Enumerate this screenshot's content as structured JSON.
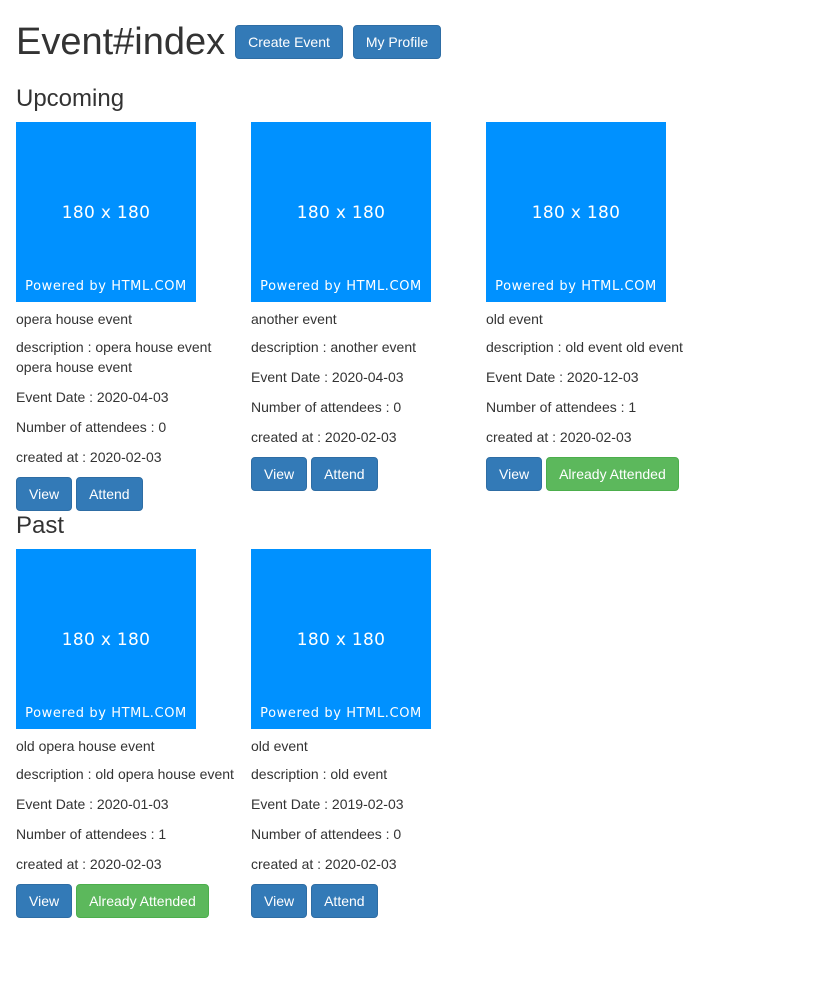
{
  "header": {
    "title": "Event#index",
    "create_event_label": "Create Event",
    "my_profile_label": "My Profile"
  },
  "upcoming": {
    "title": "Upcoming",
    "events": [
      {
        "image_size": "180 x 180",
        "image_caption": "Powered by HTML.COM",
        "name": "opera house event",
        "description": "description : opera house event opera house event",
        "event_date": "Event Date : 2020-04-03",
        "attendees": "Number of attendees : 0",
        "created_at": "created at : 2020-02-03",
        "view_label": "View",
        "attend_label": "Attend"
      },
      {
        "image_size": "180 x 180",
        "image_caption": "Powered by HTML.COM",
        "name": "another event",
        "description": "description : another event",
        "event_date": "Event Date : 2020-04-03",
        "attendees": "Number of attendees : 0",
        "created_at": "created at : 2020-02-03",
        "view_label": "View",
        "attend_label": "Attend"
      },
      {
        "image_size": "180 x 180",
        "image_caption": "Powered by HTML.COM",
        "name": "old event",
        "description": "description : old event old event",
        "event_date": "Event Date : 2020-12-03",
        "attendees": "Number of attendees : 1",
        "created_at": "created at : 2020-02-03",
        "view_label": "View",
        "attend_label": "Already Attended"
      }
    ]
  },
  "past": {
    "title": "Past",
    "events": [
      {
        "image_size": "180 x 180",
        "image_caption": "Powered by HTML.COM",
        "name": "old opera house event",
        "description": "description : old opera house event",
        "event_date": "Event Date : 2020-01-03",
        "attendees": "Number of attendees : 1",
        "created_at": "created at : 2020-02-03",
        "view_label": "View",
        "attend_label": "Already Attended"
      },
      {
        "image_size": "180 x 180",
        "image_caption": "Powered by HTML.COM",
        "name": "old event",
        "description": "description : old event",
        "event_date": "Event Date : 2019-02-03",
        "attendees": "Number of attendees : 0",
        "created_at": "created at : 2020-02-03",
        "view_label": "View",
        "attend_label": "Attend"
      }
    ]
  },
  "colors": {
    "primary": "#337ab7",
    "success": "#5cb85c",
    "placeholder": "#0091ff",
    "text": "#333333"
  }
}
